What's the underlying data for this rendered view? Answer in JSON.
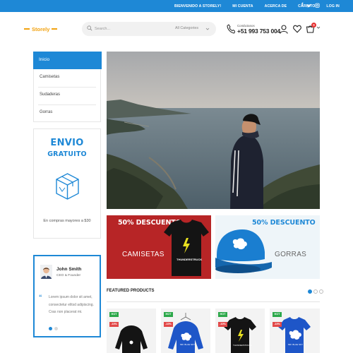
{
  "topbar": {
    "links": [
      "BIENVENIDO A STORELY!",
      "MI CUENTA",
      "ACERCA DE",
      "CARRITO",
      "LOG IN"
    ],
    "social": [
      "f",
      "t",
      "ig"
    ]
  },
  "header": {
    "logo": "Storely",
    "search_placeholder": "Search...",
    "category_select": "All Categories",
    "phone_label": "Contáctanos",
    "phone_number": "+51 993 753 004",
    "cart_count": "0"
  },
  "sidebar": {
    "items": [
      {
        "label": "Inicio",
        "active": true
      },
      {
        "label": "Camisetas"
      },
      {
        "label": "Sudaderas"
      },
      {
        "label": "Gorras"
      }
    ]
  },
  "shipping": {
    "line1": "ENVIO",
    "line2": "GRATUITO",
    "caption": "En compras mayores a $30"
  },
  "testimonial": {
    "name": "John Smith",
    "role": "CEO & Founder",
    "quote": "Lorem ipsum dolor sit amet, consectetur elitsd adipiscing. Cras non placerat mi."
  },
  "banners": [
    {
      "title": "50% DESCUENTO",
      "subtitle": "CAMISETAS",
      "bg": "#b72526"
    },
    {
      "title": "50% DESCUENTO",
      "subtitle": "GORRAS",
      "bg": "#eef5f9"
    }
  ],
  "featured": {
    "title": "FEATURED PRODUCTS",
    "products": [
      {
        "badge_hot": "HOT",
        "badge_off": "-10%",
        "icon": "black-sweatshirt"
      },
      {
        "badge_hot": "HOT",
        "badge_off": "-10%",
        "icon": "blue-hoodie"
      },
      {
        "badge_hot": "HOT",
        "badge_off": "-10%",
        "icon": "black-tshirt"
      },
      {
        "badge_hot": "HOT",
        "badge_off": "-10%",
        "icon": "blue-tshirt"
      }
    ]
  },
  "colors": {
    "accent": "#1e88d6",
    "logo": "#f2a20f",
    "hot": "#2ca84a",
    "off": "#e24848",
    "promo_red": "#b72526"
  }
}
